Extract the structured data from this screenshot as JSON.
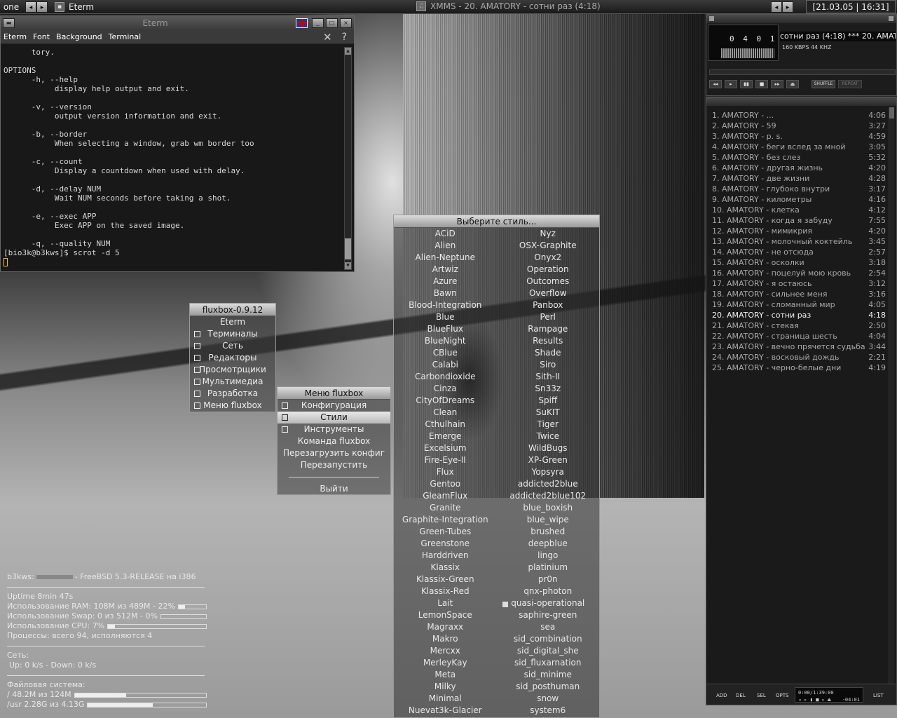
{
  "topbar": {
    "workspace": "one",
    "task1": "Eterm",
    "task2": "XMMS - 20. AMATORY - сотни раз (4:18)",
    "clock": "[21.03.05 | 16:31]"
  },
  "eterm": {
    "title": "Eterm",
    "menu": [
      "Eterm",
      "Font",
      "Background",
      "Terminal"
    ],
    "close": "✕",
    "help": "?",
    "lines": [
      "      tory.",
      "",
      "OPTIONS",
      "      -h, --help",
      "           display help output and exit.",
      "",
      "      -v, --version",
      "           output version information and exit.",
      "",
      "      -b, --border",
      "           When selecting a window, grab wm border too",
      "",
      "      -c, --count",
      "           Display a countdown when used with delay.",
      "",
      "      -d, --delay NUM",
      "           Wait NUM seconds before taking a shot.",
      "",
      "      -e, --exec APP",
      "           Exec APP on the saved image.",
      "",
      "      -q, --quality NUM"
    ],
    "prompt": "[bio3k@b3kws]$ scrot -d 5"
  },
  "root_menu": {
    "title": "fluxbox-0.9.12",
    "items": [
      "Eterm",
      "Терминалы",
      "Сеть",
      "Редакторы",
      "Просмотрщики",
      "Мультимедиа",
      "Разработка",
      "Меню fluxbox"
    ]
  },
  "fluxbox_menu": {
    "title": "Меню fluxbox",
    "items": [
      "Конфигурация",
      "Стили",
      "Инструменты",
      "Команда fluxbox",
      "Перезагрузить конфиг",
      "Перезапустить"
    ],
    "exit": "Выйти"
  },
  "styles_menu": {
    "title": "Выберите стиль...",
    "left": [
      "ACiD",
      "Alien",
      "Alien-Neptune",
      "Artwiz",
      "Azure",
      "Bawn",
      "Blood-Integration",
      "Blue",
      "BlueFlux",
      "BlueNight",
      "CBlue",
      "Calabi",
      "Carbondioxide",
      "Cinza",
      "CityOfDreams",
      "Clean",
      "Cthulhain",
      "Emerge",
      "Excelsium",
      "Fire-Eye-II",
      "Flux",
      "Gentoo",
      "GleamFlux",
      "Granite",
      "Graphite-Integration",
      "Green-Tubes",
      "Greenstone",
      "Harddriven",
      "Klassix",
      "Klassix-Green",
      "Klassix-Red",
      "Lait",
      "LemonSpace",
      "Magraxx",
      "Makro",
      "Mercxx",
      "MerleyKay",
      "Meta",
      "Milky",
      "Minimal",
      "Nuevat3k-Glacier"
    ],
    "right": [
      "Nyz",
      "OSX-Graphite",
      "Onyx2",
      "Operation",
      "Outcomes",
      "Overflow",
      "Panbox",
      "Perl",
      "Rampage",
      "Results",
      "Shade",
      "Siro",
      "Sith-II",
      "Sn33z",
      "Spiff",
      "SuKIT",
      "Tiger",
      "Twice",
      "WildBugs",
      "XP-Green",
      "Yopsyra",
      "addicted2blue",
      "addicted2blue102",
      "blue_boxish",
      "blue_wipe",
      "brushed",
      "deepblue",
      "lingo",
      "platinium",
      "pr0n",
      "qnx-photon",
      "quasi-operational",
      "saphire-green",
      "sea",
      "sid_combination",
      "sid_digital_she",
      "sid_fluxarnation",
      "sid_minime",
      "sid_posthuman",
      "snow",
      "system6"
    ]
  },
  "conky": {
    "host_prefix": "b3kws:",
    "host_suffix": "- FreeBSD 5.3-RELEASE на i386",
    "uptime": "Uptime 8min 47s",
    "ram": "Использование RAM: 108M из 489M - 22%",
    "ram_level": 22,
    "swap": "Использование Swap: 0 из 512M - 0%",
    "swap_level": 0,
    "cpu": "Использование CPU: 7%",
    "cpu_level": 7,
    "procs": "Процессы: всего 94, исполняются 4",
    "net_label": "Сеть:",
    "net": "Up: 0 k/s - Down: 0 k/s",
    "fs_label": "Файловая система:",
    "fs_root": "/ 48.2M из 124M",
    "fs_root_level": 39,
    "fs_usr": "/usr 2.28G из 4.13G",
    "fs_usr_level": 55
  },
  "xmms": {
    "time": "0 4 0 1",
    "song": "сотни раз (4:18)  ***  20. AMATORY - сотни раз",
    "kbps": "160 KBPS   44 KHZ",
    "buttons": [
      "◂◂",
      "▸",
      "▮▮",
      "■",
      "▸▸",
      "⏏"
    ],
    "shuffle": "SHUFFLE",
    "repeat": "REPEAT"
  },
  "playlist": {
    "items": [
      {
        "n": "1. AMATORY - ...",
        "d": "4:06"
      },
      {
        "n": "2. AMATORY - 59",
        "d": "3:27"
      },
      {
        "n": "3. AMATORY - p. s.",
        "d": "4:59"
      },
      {
        "n": "4. AMATORY - беги вслед за мной",
        "d": "3:05"
      },
      {
        "n": "5. AMATORY - без слез",
        "d": "5:32"
      },
      {
        "n": "6. AMATORY - другая жизнь",
        "d": "4:20"
      },
      {
        "n": "7. AMATORY - две жизни",
        "d": "4:28"
      },
      {
        "n": "8. AMATORY - глубоко внутри",
        "d": "3:17"
      },
      {
        "n": "9. AMATORY - километры",
        "d": "4:16"
      },
      {
        "n": "10. AMATORY - клетка",
        "d": "4:12"
      },
      {
        "n": "11. AMATORY - когда я забуду",
        "d": "7:55"
      },
      {
        "n": "12. AMATORY - мимикрия",
        "d": "4:20"
      },
      {
        "n": "13. AMATORY - молочный коктейль",
        "d": "3:45"
      },
      {
        "n": "14. AMATORY - не отсюда",
        "d": "2:57"
      },
      {
        "n": "15. AMATORY - осколки",
        "d": "3:18"
      },
      {
        "n": "16. AMATORY - поцелуй мою кровь",
        "d": "2:54"
      },
      {
        "n": "17. AMATORY - я остаюсь",
        "d": "3:12"
      },
      {
        "n": "18. AMATORY - сильнее меня",
        "d": "3:16"
      },
      {
        "n": "19. AMATORY - сломанный мир",
        "d": "4:05"
      },
      {
        "n": "20. AMATORY - сотни раз",
        "d": "4:18"
      },
      {
        "n": "21. AMATORY - стекая",
        "d": "2:50"
      },
      {
        "n": "22. AMATORY - страница шесть",
        "d": "4:04"
      },
      {
        "n": "23. AMATORY - вечно прячется судьба",
        "d": "3:44"
      },
      {
        "n": "24. AMATORY - восковый дождь",
        "d": "2:21"
      },
      {
        "n": "25. AMATORY - черно-белые дни",
        "d": "4:19"
      }
    ],
    "current": 19,
    "bottom": [
      "ADD",
      "DEL",
      "SEL",
      "OPTS",
      "LIST"
    ],
    "mini_time": "0:00/1:39:00",
    "mini_pos": "-04:01"
  }
}
